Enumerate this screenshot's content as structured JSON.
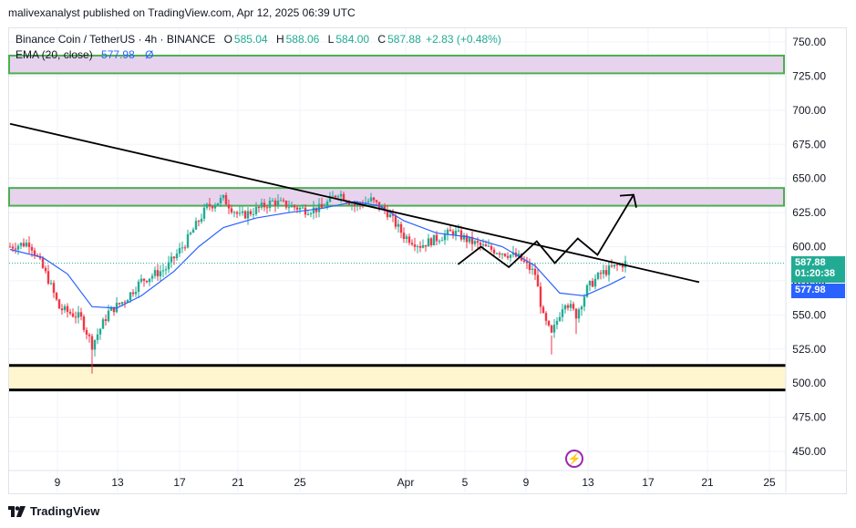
{
  "credit": "malivexanalyst published on TradingView.com, Apr 12, 2025 06:39 UTC",
  "legend": {
    "symbol": "Binance Coin / TetherUS · 4h · BINANCE",
    "open_key": "O",
    "open": "585.04",
    "high_key": "H",
    "high": "588.06",
    "low_key": "L",
    "low": "584.00",
    "close_key": "C",
    "close": "587.88",
    "change": "+2.83 (+0.48%)",
    "ema_label": "EMA (20, close)",
    "ema_value": "577.98",
    "ema_extra": "Ø"
  },
  "price_tags": {
    "last_price": "587.88",
    "countdown": "01:20:38",
    "ema_price": "577.98"
  },
  "footer": {
    "brand": "TradingView"
  },
  "icons": {
    "flash": "lightning-icon",
    "logo": "tradingview-logo-icon"
  },
  "colors": {
    "up": "#22ab94",
    "down": "#f23645",
    "ema": "#2962ff",
    "zone_fill": "#e7d3ee",
    "zone_border": "#4caf50",
    "support_fill": "#fff6cf",
    "trendline": "#000000"
  },
  "chart_data": {
    "type": "candlestick",
    "y_ticks": [
      "750.00",
      "725.00",
      "700.00",
      "675.00",
      "650.00",
      "625.00",
      "600.00",
      "575.00",
      "550.00",
      "525.00",
      "500.00",
      "475.00",
      "450.00"
    ],
    "ylim": [
      440,
      760
    ],
    "x_ticks": [
      "9",
      "13",
      "17",
      "21",
      "25",
      "Apr",
      "5",
      "9",
      "13",
      "17",
      "21",
      "25"
    ],
    "grid": true,
    "zones": [
      {
        "kind": "resistance",
        "low": 727,
        "high": 740
      },
      {
        "kind": "resistance",
        "low": 630,
        "high": 643
      },
      {
        "kind": "support",
        "low": 495,
        "high": 513
      }
    ],
    "trendline": {
      "from": {
        "day": 5.0,
        "price": 690
      },
      "to": {
        "day": 47.0,
        "price": 574
      }
    },
    "projection": [
      {
        "day": 32.3,
        "price": 587
      },
      {
        "day": 33.7,
        "price": 600
      },
      {
        "day": 35.4,
        "price": 585
      },
      {
        "day": 37.1,
        "price": 604
      },
      {
        "day": 38.2,
        "price": 588
      },
      {
        "day": 39.6,
        "price": 606
      },
      {
        "day": 40.8,
        "price": 594
      },
      {
        "day": 43.0,
        "price": 638
      }
    ],
    "candles_summary": [
      {
        "day": 5.0,
        "price": 600
      },
      {
        "day": 6.2,
        "price": 603
      },
      {
        "day": 7.3,
        "price": 577
      },
      {
        "day": 8.0,
        "price": 555
      },
      {
        "day": 9.3,
        "price": 548
      },
      {
        "day": 10.0,
        "price": 528
      },
      {
        "day": 11.0,
        "price": 552
      },
      {
        "day": 12.0,
        "price": 561
      },
      {
        "day": 13.0,
        "price": 575
      },
      {
        "day": 14.5,
        "price": 584
      },
      {
        "day": 15.7,
        "price": 603
      },
      {
        "day": 17.0,
        "price": 629
      },
      {
        "day": 18.0,
        "price": 635
      },
      {
        "day": 19.0,
        "price": 622
      },
      {
        "day": 20.0,
        "price": 627
      },
      {
        "day": 21.0,
        "price": 633
      },
      {
        "day": 22.0,
        "price": 630
      },
      {
        "day": 23.0,
        "price": 627
      },
      {
        "day": 24.0,
        "price": 628
      },
      {
        "day": 25.0,
        "price": 640
      },
      {
        "day": 26.0,
        "price": 630
      },
      {
        "day": 27.0,
        "price": 634
      },
      {
        "day": 28.0,
        "price": 625
      },
      {
        "day": 29.0,
        "price": 608
      },
      {
        "day": 30.0,
        "price": 601
      },
      {
        "day": 31.0,
        "price": 606
      },
      {
        "day": 32.0,
        "price": 611
      },
      {
        "day": 33.0,
        "price": 604
      },
      {
        "day": 34.0,
        "price": 599
      },
      {
        "day": 35.0,
        "price": 596
      },
      {
        "day": 36.0,
        "price": 592
      },
      {
        "day": 37.0,
        "price": 580
      },
      {
        "day": 37.5,
        "price": 548
      },
      {
        "day": 38.0,
        "price": 535
      },
      {
        "day": 38.8,
        "price": 561
      },
      {
        "day": 39.5,
        "price": 550
      },
      {
        "day": 40.2,
        "price": 570
      },
      {
        "day": 41.0,
        "price": 580
      },
      {
        "day": 41.8,
        "price": 585
      },
      {
        "day": 42.5,
        "price": 588
      }
    ],
    "ema_summary": [
      {
        "day": 5.0,
        "price": 598
      },
      {
        "day": 7.0,
        "price": 592
      },
      {
        "day": 8.5,
        "price": 580
      },
      {
        "day": 10.0,
        "price": 556
      },
      {
        "day": 11.5,
        "price": 555
      },
      {
        "day": 13.0,
        "price": 564
      },
      {
        "day": 15.0,
        "price": 582
      },
      {
        "day": 16.5,
        "price": 600
      },
      {
        "day": 18.0,
        "price": 614
      },
      {
        "day": 20.0,
        "price": 621
      },
      {
        "day": 22.0,
        "price": 625
      },
      {
        "day": 24.0,
        "price": 628
      },
      {
        "day": 26.0,
        "price": 633
      },
      {
        "day": 27.5,
        "price": 630
      },
      {
        "day": 29.0,
        "price": 619
      },
      {
        "day": 31.0,
        "price": 610
      },
      {
        "day": 33.0,
        "price": 607
      },
      {
        "day": 35.0,
        "price": 600
      },
      {
        "day": 37.0,
        "price": 586
      },
      {
        "day": 38.5,
        "price": 566
      },
      {
        "day": 40.0,
        "price": 564
      },
      {
        "day": 41.5,
        "price": 572
      },
      {
        "day": 42.5,
        "price": 578
      }
    ]
  }
}
